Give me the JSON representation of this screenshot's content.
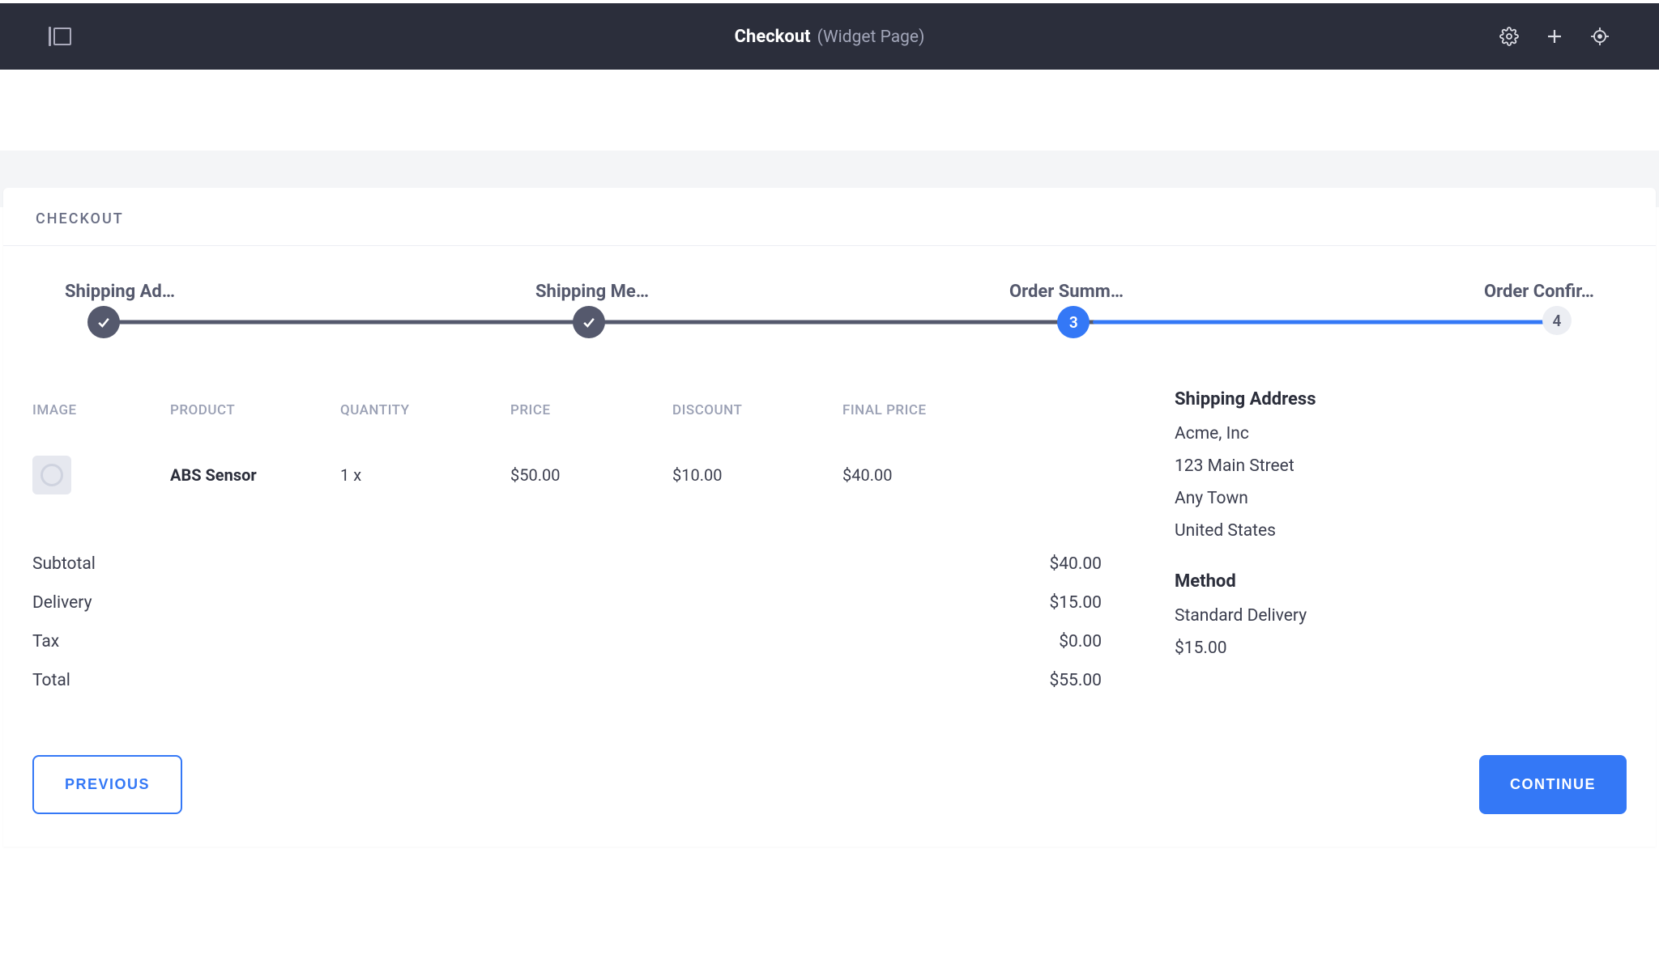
{
  "header": {
    "title": "Checkout",
    "subtitle": "(Widget Page)"
  },
  "card": {
    "title": "CHECKOUT"
  },
  "stepper": {
    "steps": [
      {
        "label": "Shipping Ad…",
        "state": "done"
      },
      {
        "label": "Shipping Me…",
        "state": "done"
      },
      {
        "label": "Order Summ…",
        "state": "current",
        "num": "3"
      },
      {
        "label": "Order Confir…",
        "state": "future",
        "num": "4"
      }
    ]
  },
  "table": {
    "headers": {
      "image": "IMAGE",
      "product": "PRODUCT",
      "quantity": "QUANTITY",
      "price": "PRICE",
      "discount": "DISCOUNT",
      "final_price": "FINAL PRICE"
    },
    "rows": [
      {
        "product": "ABS Sensor",
        "quantity": "1  x",
        "price": "$50.00",
        "discount": "$10.00",
        "final_price": "$40.00"
      }
    ]
  },
  "totals": {
    "subtotal": {
      "label": "Subtotal",
      "value": "$40.00"
    },
    "delivery": {
      "label": "Delivery",
      "value": "$15.00"
    },
    "tax": {
      "label": "Tax",
      "value": "$0.00"
    },
    "total": {
      "label": "Total",
      "value": "$55.00"
    }
  },
  "shipping_address": {
    "title": "Shipping Address",
    "lines": [
      "Acme, Inc",
      "123 Main Street",
      "Any Town",
      "United States"
    ]
  },
  "method": {
    "title": "Method",
    "name": "Standard Delivery",
    "price": "$15.00"
  },
  "actions": {
    "previous": "PREVIOUS",
    "continue": "CONTINUE"
  }
}
